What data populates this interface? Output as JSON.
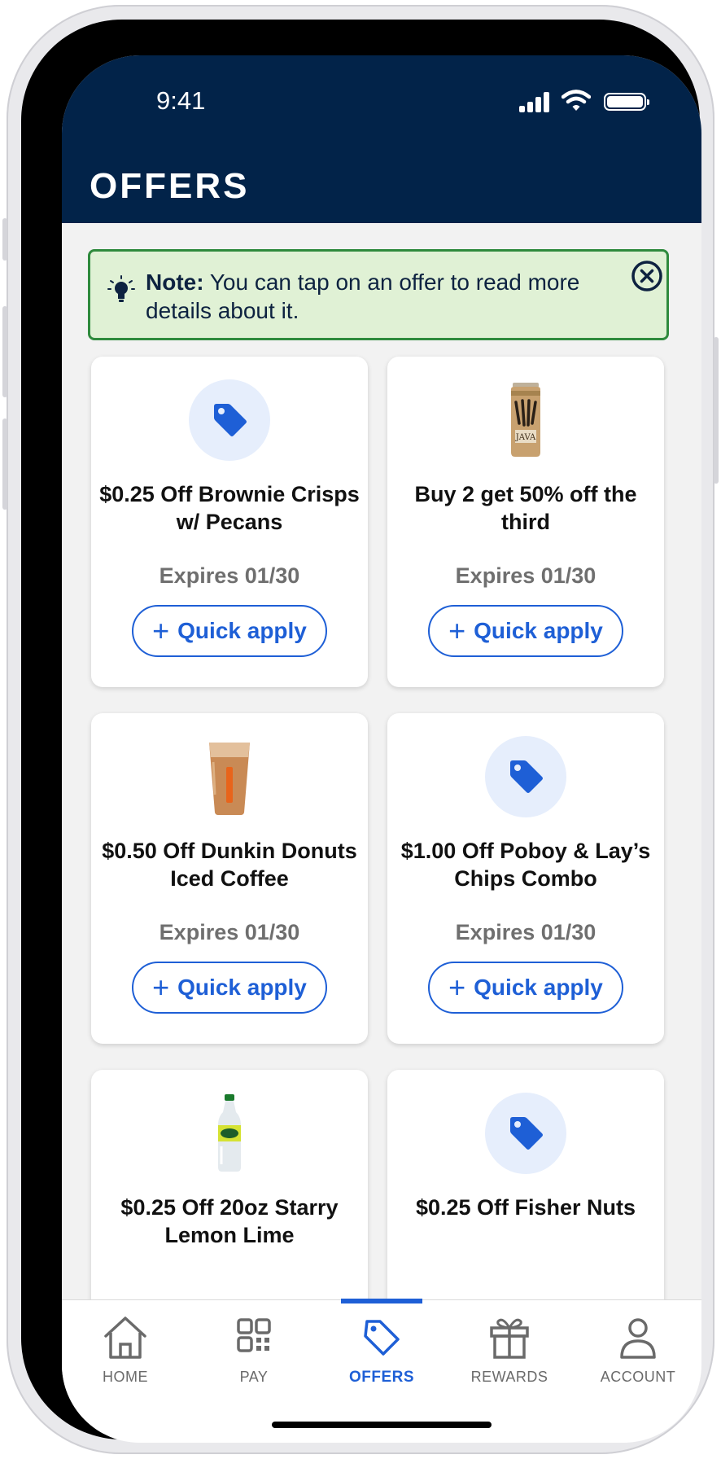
{
  "status_bar": {
    "time": "9:41"
  },
  "header": {
    "title": "OFFERS"
  },
  "note": {
    "label": "Note:",
    "text": " You can tap on an offer to read more details about it.",
    "icon": "lightbulb-icon",
    "close_icon": "close-circle-icon"
  },
  "offers": [
    {
      "title": "$0.25 Off Brownie Crisps w/ Pecans",
      "expires": "Expires 01/30",
      "button": "Quick apply",
      "image": "tag-icon"
    },
    {
      "title": "Buy 2 get 50% off the third",
      "expires": "Expires 01/30",
      "button": "Quick apply",
      "image": "energy-drink-can"
    },
    {
      "title": "$0.50 Off Dunkin Donuts Iced Coffee",
      "expires": "Expires 01/30",
      "button": "Quick apply",
      "image": "iced-coffee-cup"
    },
    {
      "title": "$1.00 Off Poboy & Lay’s Chips Combo",
      "expires": "Expires 01/30",
      "button": "Quick apply",
      "image": "tag-icon"
    },
    {
      "title": "$0.25 Off 20oz Starry Lemon Lime",
      "image": "soda-bottle"
    },
    {
      "title": "$0.25 Off Fisher Nuts",
      "image": "tag-icon"
    }
  ],
  "tabbar": {
    "items": [
      {
        "label": "HOME",
        "icon": "home-icon"
      },
      {
        "label": "PAY",
        "icon": "qr-code-icon"
      },
      {
        "label": "OFFERS",
        "icon": "tag-icon",
        "active": true
      },
      {
        "label": "REWARDS",
        "icon": "gift-icon"
      },
      {
        "label": "ACCOUNT",
        "icon": "person-icon"
      }
    ]
  },
  "colors": {
    "header_bg": "#022349",
    "accent": "#1e5fd6",
    "note_bg": "#e0f1d5",
    "note_border": "#2f8a3d"
  }
}
